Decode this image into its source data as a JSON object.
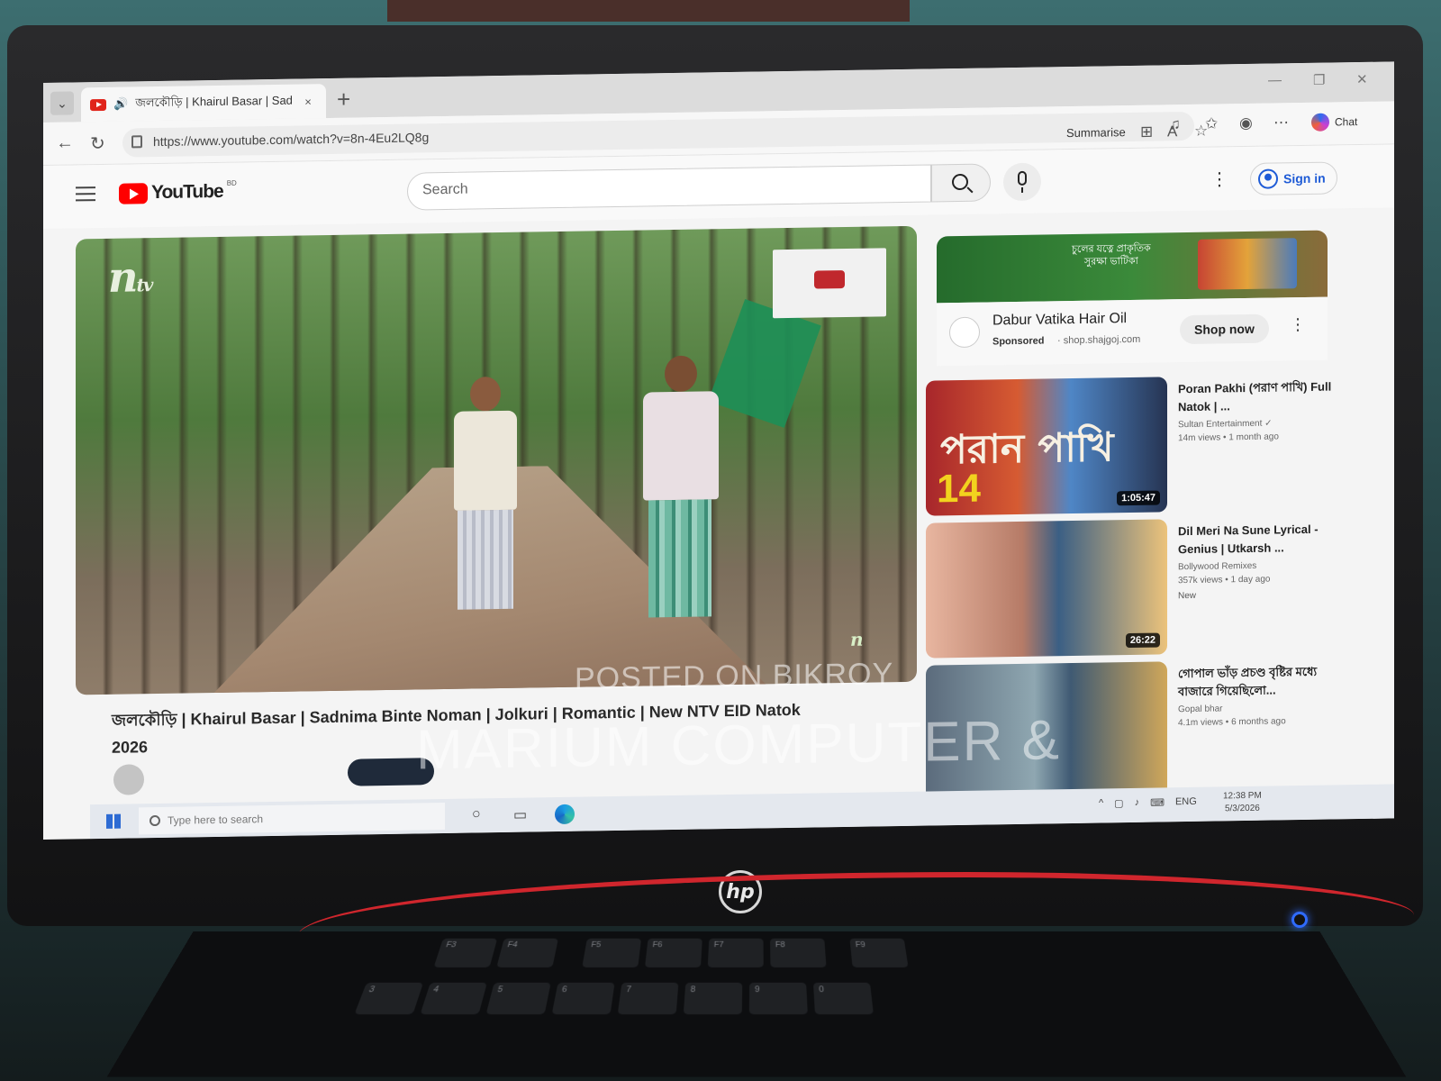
{
  "browser": {
    "tab_menu_icon": "chevron-down-icon",
    "tab_title": "জলকৌড়ি | Khairul Basar | Sad",
    "tab_audio_icon": "speaker-icon",
    "tab_close": "×",
    "new_tab": "+",
    "url": "https://www.youtube.com/watch?v=8n-4Eu2LQ8g",
    "summarise_label": "Summarise",
    "copilot_label": "Chat",
    "window_controls": [
      "—",
      "❐",
      "✕"
    ]
  },
  "youtube": {
    "logo_text": "YouTube",
    "logo_region": "BD",
    "search_placeholder": "Search",
    "signin_label": "Sign in"
  },
  "video": {
    "channel_logo": "n",
    "channel_logo_sub": "tv",
    "corner_logo": "n",
    "title_line1": "জলকৌড়ি | Khairul Basar | Sadnima Binte Noman | Jolkuri | Romantic | New NTV EID Natok",
    "title_line2": "2026"
  },
  "ad": {
    "banner_text": "চুলের যত্নে প্রাকৃতিক\nসুরক্ষা ভাটিকা",
    "title": "Dabur Vatika Hair Oil",
    "sponsored": "Sponsored",
    "domain": "· shop.shajgoj.com",
    "cta": "Shop now"
  },
  "recommendations": [
    {
      "thumb_text": "পরান পাখি",
      "thumb_badge": "14",
      "title": "Poran Pakhi (পরাণ পাখি) Full Natok | ...",
      "channel": "Sultan Entertainment ✓",
      "stats": "14m views • 1 month ago",
      "duration": "1:05:47",
      "badge": ""
    },
    {
      "thumb_text": "",
      "thumb_badge": "",
      "title": "Dil Meri Na Sune Lyrical - Genius | Utkarsh ...",
      "channel": "Bollywood Remixes",
      "stats": "357k views • 1 day ago",
      "duration": "26:22",
      "badge": "New"
    },
    {
      "thumb_text": "",
      "thumb_badge": "",
      "title": "গোপাল ভাঁড় প্রচণ্ড বৃষ্টির মধ্যে বাজারে গিয়েছিলো...",
      "channel": "Gopal bhar",
      "stats": "4.1m views • 6 months ago",
      "duration": "",
      "badge": ""
    }
  ],
  "taskbar": {
    "search_placeholder": "Type here to search",
    "lang": "ENG",
    "time": "12:38 PM",
    "date": "5/3/2026"
  },
  "watermark": {
    "line1": "POSTED ON BIKROY",
    "line2": "MARIUM COMPUTER &"
  },
  "monitor": {
    "brand": "hp"
  },
  "keyboard": {
    "fkeys": [
      "F3",
      "F4",
      "F5",
      "F6",
      "F7",
      "F8",
      "F9"
    ],
    "numkeys": [
      "3",
      "4",
      "5",
      "6",
      "7",
      "8",
      "9",
      "0"
    ]
  },
  "colors": {
    "youtube_red": "#ff0000",
    "signin_blue": "#1e5bd6",
    "power_led": "#2f6bff",
    "cable": "#d0262d"
  }
}
